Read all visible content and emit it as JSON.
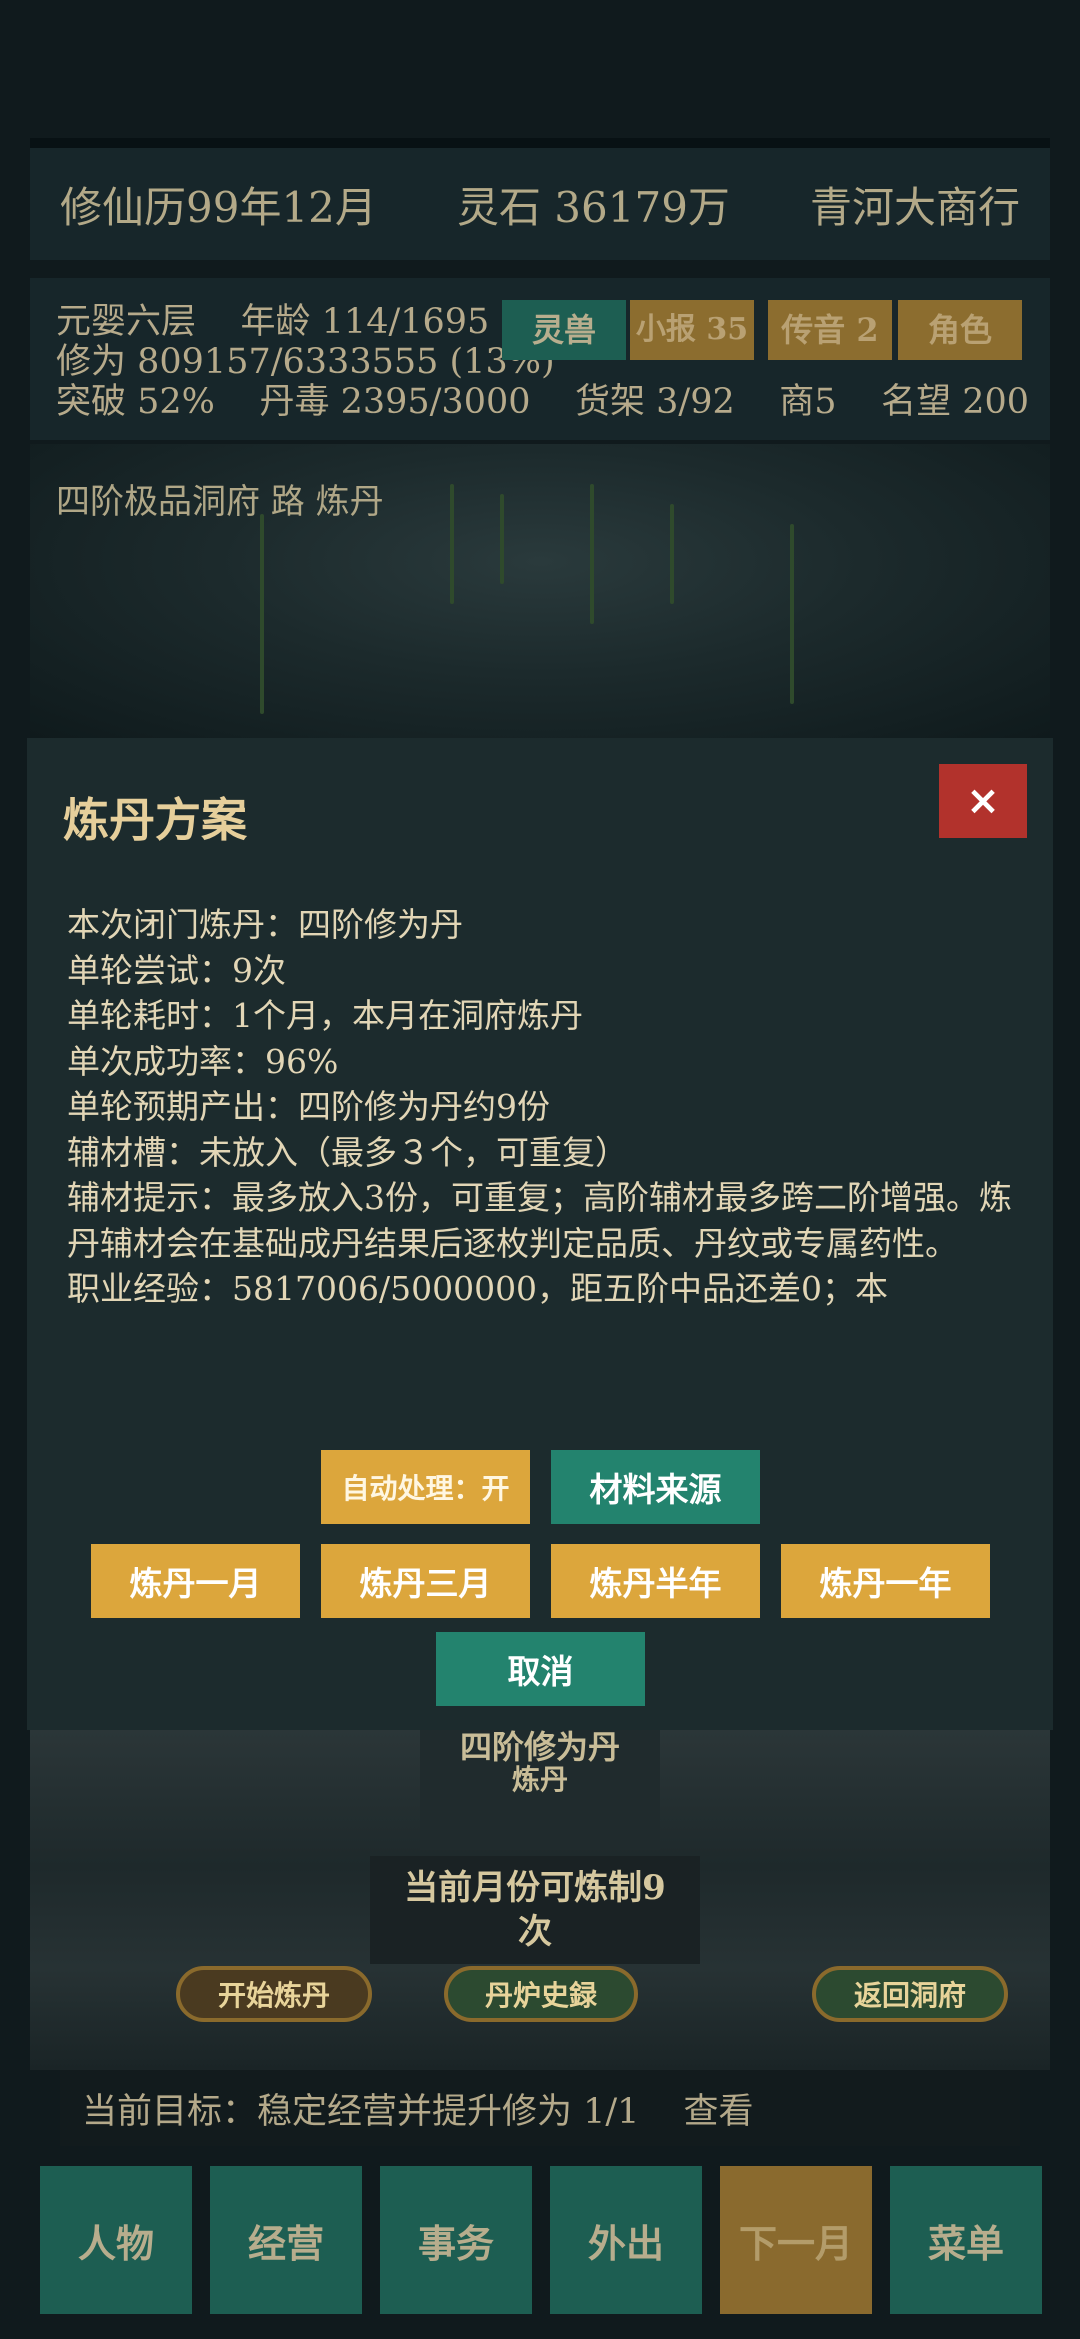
{
  "header": {
    "date": "修仙历99年12月",
    "spirit_stones": "灵石 36179万",
    "shop": "青河大商行"
  },
  "stats": {
    "realm": "元婴六层",
    "age": "年龄 114/1695",
    "cultivation": "修为 809157/6333555 (13%)",
    "breakthrough": "突破 52%",
    "pill_toxicity": "丹毒 2395/3000",
    "shelf": "货架 3/92",
    "shop_count": "商5",
    "reputation": "名望 200",
    "buttons": {
      "spirit_beast": "灵兽",
      "newspaper": "小报 35",
      "messages": "传音 2",
      "character": "角色"
    }
  },
  "location": "四阶极品洞府 路 炼丹",
  "modal": {
    "title": "炼丹方案",
    "close": "×",
    "lines": [
      "本次闭门炼丹：四阶修为丹",
      "单轮尝试：9次",
      "单轮耗时：1个月，本月在洞府炼丹",
      "单次成功率：96%",
      "单轮预期产出：四阶修为丹约9份",
      "辅材槽：未放入（最多３个，可重复）"
    ],
    "tip": "辅材提示：最多放入3份，可重复；高阶辅材最多跨二阶增强。炼丹辅材会在基础成丹结果后逐枚判定品质、丹纹或专属药性。",
    "exp": "职业经验：5817006/5000000，距五阶中品还差0；本",
    "auto_process": "自动处理：开",
    "material_source": "材料来源",
    "options": [
      "炼丹一月",
      "炼丹三月",
      "炼丹半年",
      "炼丹一年"
    ],
    "cancel": "取消"
  },
  "scene": {
    "stele_line1": "四阶修为丹",
    "stele_line2": "炼丹",
    "capacity": "当前月份可炼制9次",
    "start_alchemy": "开始炼丹",
    "furnace_history": "丹炉史録",
    "return_cave": "返回洞府"
  },
  "goal": {
    "text": "当前目标：稳定经营并提升修为 1/1",
    "view": "查看"
  },
  "nav": [
    "人物",
    "经营",
    "事务",
    "外出",
    "下一月",
    "菜单"
  ]
}
